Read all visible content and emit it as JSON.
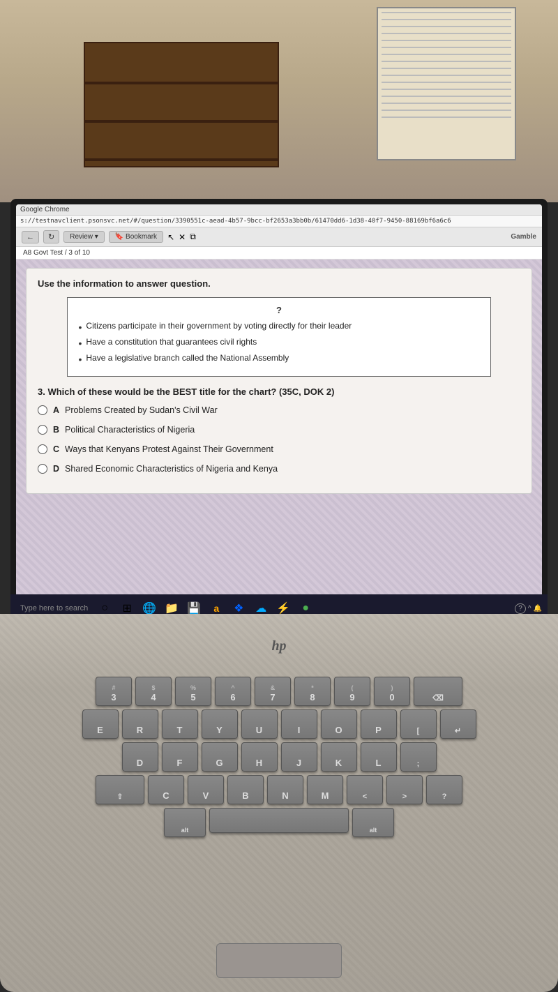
{
  "room": {
    "desc": "Room background with window blinds and bookcase"
  },
  "browser": {
    "title": "Google Chrome",
    "url": "s://testnavclient.psonsvc.net/#/question/3390551c-aead-4b57-9bcc-bf2653a3bb0b/61470dd6-1d38-40f7-9450-88169bf6a6c6",
    "back_btn": "←",
    "forward_btn": "↻",
    "review_label": "Review ▾",
    "bookmark_label": "🔖 Bookmark",
    "brand_label": "Gamble",
    "breadcrumb": "A8 Govt Test  /  3 of 10"
  },
  "question": {
    "instruction": "Use the information to answer question.",
    "chart_title": "?",
    "bullet1": "Citizens participate in their government by voting directly for their leader",
    "bullet2": "Have a constitution that guarantees civil rights",
    "bullet3": "Have a legislative branch called the National Assembly",
    "question_text": "3. Which of these would be the BEST title for the chart? (35C, DOK 2)",
    "options": [
      {
        "id": "A",
        "text": "Problems Created by Sudan's Civil War"
      },
      {
        "id": "B",
        "text": "Political Characteristics of Nigeria"
      },
      {
        "id": "C",
        "text": "Ways that Kenyans Protest Against Their Government"
      },
      {
        "id": "D",
        "text": "Shared Economic Characteristics of Nigeria and Kenya"
      }
    ]
  },
  "taskbar": {
    "search_placeholder": "Type here to search",
    "icons": [
      "○",
      "⊞",
      "🌐",
      "📁",
      "💾",
      "a",
      "❖",
      "☁",
      "⚡",
      "🌑"
    ]
  },
  "keyboard": {
    "rows": [
      [
        "#3",
        "$4",
        "% 5",
        "^ 6",
        "& 7",
        "* 8",
        "( 9",
        ") 0"
      ],
      [
        "E",
        "R",
        "T",
        "Y",
        "U",
        "I",
        "O",
        "P"
      ],
      [
        "D",
        "F",
        "G",
        "H",
        "J",
        "K",
        "L"
      ],
      [
        "C",
        "V",
        "B",
        "N",
        "M"
      ]
    ]
  }
}
